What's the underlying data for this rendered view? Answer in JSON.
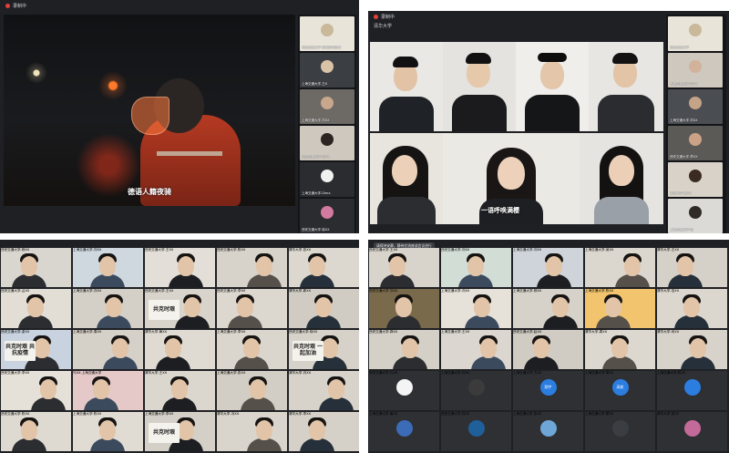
{
  "quad1": {
    "meeting_title": "录制中",
    "caption": "德语人籍夜骑",
    "side": [
      {
        "label": "西安交通大学-吴曦鲜明嘉年",
        "bg": "#e9e4da",
        "av": "#c9b89a"
      },
      {
        "label": "上海交通大学-王X",
        "bg": "#3b3f44",
        "av": "#d9c2a6"
      },
      {
        "label": "上海交通大学-刘XX",
        "bg": "#6d6a66",
        "av": "#c8a78c"
      },
      {
        "label": "西安交通大学-刘XX",
        "bg": "#cfc8be",
        "av": "#2c2420"
      },
      {
        "label": "上海交通大学-Dima",
        "bg": "#2a2c30",
        "av": "#f1f1f1"
      },
      {
        "label": "西安交通大学-徐XX",
        "bg": "#2a2c30",
        "av": "#d37aa0"
      }
    ]
  },
  "quad2": {
    "meeting_title": "录制中",
    "mic_status": "清华大学",
    "subtitle": "一语呼唤满樱",
    "side": [
      {
        "label": "西安交通大学",
        "bg": "#e9e4da",
        "av": "#c9b89a"
      },
      {
        "label": "上海交通大学-徐XX",
        "bg": "#cfc8be",
        "av": "#d2b29a"
      },
      {
        "label": "上海交通大学-刘XX",
        "bg": "#4a4d52",
        "av": "#c4a387"
      },
      {
        "label": "西安交通大学-李XX",
        "bg": "#5c5a57",
        "av": "#cba286"
      },
      {
        "label": "清华大学-黄XX",
        "bg": "#d8d2c8",
        "av": "#3a2a22"
      },
      {
        "label": "上海交通大学-杨",
        "bg": "#dcdad6",
        "av": "#2f2a26"
      }
    ]
  },
  "quad3": {
    "tiles": [
      {
        "label": "西安交通大学-杨XX",
        "bg": "#d9d6cf",
        "sign": ""
      },
      {
        "label": "上海交通大学-刘XX",
        "bg": "#cfd7df",
        "sign": ""
      },
      {
        "label": "西安交通大学-王XX",
        "bg": "#e3dfd8",
        "sign": ""
      },
      {
        "label": "西安交通大学-陈XX",
        "bg": "#d8d3ca",
        "sign": ""
      },
      {
        "label": "清华大学-张XX",
        "bg": "#dcd8cf",
        "sign": ""
      },
      {
        "label": "西安交通大学-吕XX",
        "bg": "#e2ddd5",
        "sign": ""
      },
      {
        "label": "上海交通大学-刘XX",
        "bg": "#d4d0c8",
        "sign": ""
      },
      {
        "label": "西安交通大学-王XX",
        "bg": "#d9d4cb",
        "sign": "共克时艰"
      },
      {
        "label": "西安交通大学-李XX",
        "bg": "#ddd8cf",
        "sign": ""
      },
      {
        "label": "清华大学-郭XX",
        "bg": "#d0ccc4",
        "sign": ""
      },
      {
        "label": "西安交通大学-梁XX",
        "bg": "#c9d3df",
        "sign": "共克时艰 共抗疫情"
      },
      {
        "label": "上海交通大学-周XX",
        "bg": "#d6d1c8",
        "sign": ""
      },
      {
        "label": "清华大学-黄XX",
        "bg": "#e0dbd2",
        "sign": ""
      },
      {
        "label": "上海交通大学-李XX",
        "bg": "#dbd6cd",
        "sign": ""
      },
      {
        "label": "西安交通大学-徐XX",
        "bg": "#d7d2c9",
        "sign": "共克时艰 一起加油"
      },
      {
        "label": "西安交通大学-李XX",
        "bg": "#e6e1d8",
        "sign": ""
      },
      {
        "label": "马XX-上海交通大学",
        "bg": "#e5c9c9",
        "sign": ""
      },
      {
        "label": "清华大学-王XX",
        "bg": "#dcd7ce",
        "sign": ""
      },
      {
        "label": "上海交通大学-张XX",
        "bg": "#d3cec5",
        "sign": ""
      },
      {
        "label": "清华大学-刘XX",
        "bg": "#d8d3ca",
        "sign": ""
      },
      {
        "label": "西安交通大学-陈XX",
        "bg": "#dedad2",
        "sign": ""
      },
      {
        "label": "上海交通大学-陈XX",
        "bg": "#e0dcd4",
        "sign": ""
      },
      {
        "label": "上海交通大学-李XX",
        "bg": "#d5d0c7",
        "sign": "共克时艰"
      },
      {
        "label": "清华大学-冯XX",
        "bg": "#dad5cc",
        "sign": ""
      },
      {
        "label": "清华大学-李XX",
        "bg": "#d6d1c8",
        "sign": ""
      }
    ]
  },
  "quad4": {
    "banner": "请保持安静，静待交流座谈会议进行",
    "tiles": [
      {
        "label": "西安交通大学-王XX",
        "bg": "#d8d4cc",
        "kind": "cam"
      },
      {
        "label": "西安交通大学-刘XX",
        "bg": "#d2ddd6",
        "kind": "cam"
      },
      {
        "label": "上海交通大学-刘XX",
        "bg": "#cfd4da",
        "kind": "cam"
      },
      {
        "label": "上海交通大学-吴XX",
        "bg": "#dcd7ce",
        "kind": "cam"
      },
      {
        "label": "清华大学-王XX",
        "bg": "#d6d1c8",
        "kind": "cam"
      },
      {
        "label": "西安交通大学-刘XX",
        "bg": "#7a6a4c",
        "kind": "cam"
      },
      {
        "label": "上海交通大学-刘XX",
        "bg": "#e6e2da",
        "kind": "cam"
      },
      {
        "label": "上海交通大学-杨XX",
        "bg": "#d6d2ca",
        "kind": "cam"
      },
      {
        "label": "上海交通大学-陈XX",
        "bg": "#f2c46e",
        "kind": "cam"
      },
      {
        "label": "清华大学-范XX",
        "bg": "#dcd7ce",
        "kind": "cam"
      },
      {
        "label": "西安交通大学-郭XX",
        "bg": "#d5d0c7",
        "kind": "cam"
      },
      {
        "label": "上海交通大学-王XX",
        "bg": "#dbd7d0",
        "kind": "cam"
      },
      {
        "label": "西安交通大学-赵XX",
        "bg": "#d0ccc4",
        "kind": "cam"
      },
      {
        "label": "清华大学-周XX",
        "bg": "#dcd8d0",
        "kind": "cam"
      },
      {
        "label": "清华大学-何XX",
        "bg": "#d8d3ca",
        "kind": "cam"
      },
      {
        "label": "西安交通大学-孔XX",
        "bg": "#2e3034",
        "kind": "av",
        "av": "#f4f4f4",
        "text": ""
      },
      {
        "label": "上海交通大学-刘XX",
        "bg": "#2e3034",
        "kind": "av",
        "av": "#3b3b3b",
        "text": ""
      },
      {
        "label": "上海交通大学-方XX",
        "bg": "#2e3034",
        "kind": "av",
        "av": "#2b7de0",
        "text": "翔宇"
      },
      {
        "label": "上海交通大学-周XX",
        "bg": "#2e3034",
        "kind": "av",
        "av": "#2b7de0",
        "text": "高航"
      },
      {
        "label": "上海交通大学-陈XX",
        "bg": "#2e3034",
        "kind": "av",
        "av": "#2b7de0",
        "text": ""
      },
      {
        "label": "上海交通大学-姜XX",
        "bg": "#2e3034",
        "kind": "av",
        "av": "#3c6bb8",
        "text": ""
      },
      {
        "label": "西安交通大学-任XX",
        "bg": "#2e3034",
        "kind": "av",
        "av": "#1f5f9a",
        "text": ""
      },
      {
        "label": "上海交通大学-张XX",
        "bg": "#2e3034",
        "kind": "av",
        "av": "#6fa6d8",
        "text": ""
      },
      {
        "label": "上海交通大学-霍XX",
        "bg": "#2e3034",
        "kind": "av",
        "av": "#3a3d42",
        "text": ""
      },
      {
        "label": "清华大学-张XX",
        "bg": "#2e3034",
        "kind": "av",
        "av": "#c46a9a",
        "text": ""
      }
    ]
  },
  "colors": {
    "frame": "#1f2024",
    "side": "#141518",
    "record": "#e2403a",
    "avatar_blue": "#2b7de0"
  }
}
